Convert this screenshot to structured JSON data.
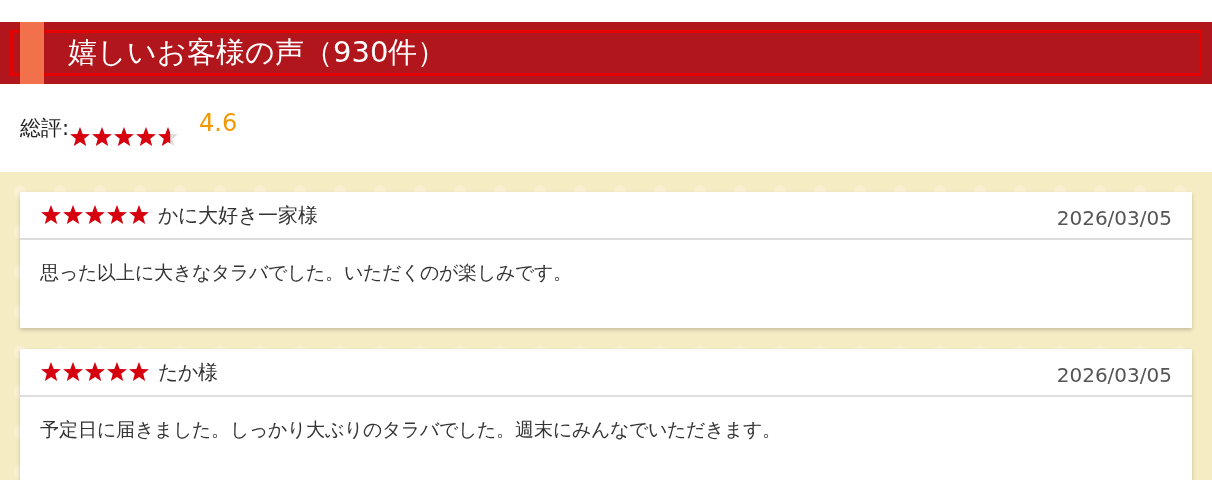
{
  "heading": {
    "title": "嬉しいお客様の声（930件）"
  },
  "summary": {
    "label": "総評:",
    "stars": 4.6,
    "score": "4.6"
  },
  "reviews": [
    {
      "stars": 5,
      "name": "かに大好き一家様",
      "date": "2026/03/05",
      "text": "思った以上に大きなタラバでした。いただくのが楽しみです。"
    },
    {
      "stars": 5,
      "name": "たか様",
      "date": "2026/03/05",
      "text": "予定日に届きました。しっかり大ぶりのタラバでした。週末にみんなでいただきます。"
    }
  ]
}
